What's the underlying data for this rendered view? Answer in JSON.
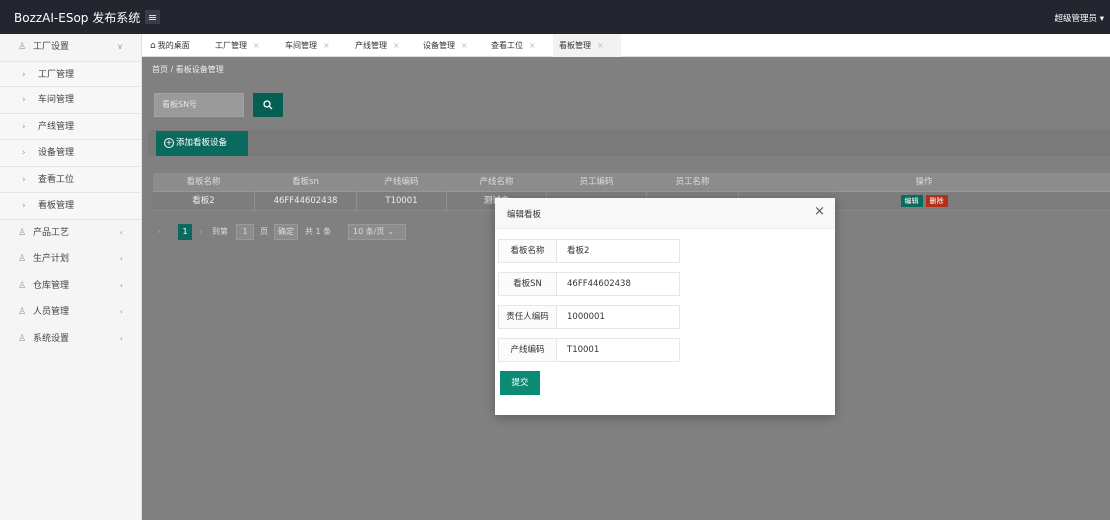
{
  "header": {
    "brand": "BozzAI-ESop 发布系统",
    "user": "超级管理员 ▾"
  },
  "sidebar": {
    "groups": [
      {
        "label": "工厂设置",
        "expanded": true
      },
      {
        "label": "产品工艺"
      },
      {
        "label": "生产计划"
      },
      {
        "label": "仓库管理"
      },
      {
        "label": "人员管理"
      },
      {
        "label": "系统设置"
      }
    ],
    "sub_items": [
      {
        "label": "工厂管理"
      },
      {
        "label": "车间管理"
      },
      {
        "label": "产线管理"
      },
      {
        "label": "设备管理"
      },
      {
        "label": "查看工位"
      },
      {
        "label": "看板管理"
      }
    ]
  },
  "tabs": [
    {
      "label": "我的桌面"
    },
    {
      "label": "工厂管理"
    },
    {
      "label": "车间管理"
    },
    {
      "label": "产线管理"
    },
    {
      "label": "设备管理"
    },
    {
      "label": "查看工位"
    },
    {
      "label": "看板管理",
      "active": true
    }
  ],
  "breadcrumb": "首页 / 看板设备管理",
  "search": {
    "placeholder": "看板SN号"
  },
  "add_button": "添加看板设备",
  "table": {
    "columns": [
      "看板名称",
      "看板sn",
      "产线编码",
      "产线名称",
      "员工编码",
      "员工名称",
      "操作"
    ],
    "rows": [
      {
        "name": "看板2",
        "sn": "46FF44602438",
        "line_code": "T10001",
        "line_name": "测试产",
        "emp_code": "",
        "emp_name": "",
        "edit": "编辑",
        "delete": "删除"
      }
    ]
  },
  "pagination": {
    "current": "1",
    "goto_label": "到第",
    "goto_value": "1",
    "page_unit": "页",
    "confirm": "确定",
    "total": "共 1 条",
    "page_size": "10 条/页"
  },
  "modal": {
    "title": "编辑看板",
    "fields": [
      {
        "label": "看板名称",
        "value": "看板2"
      },
      {
        "label": "看板SN",
        "value": "46FF44602438"
      },
      {
        "label": "责任人编码",
        "value": "1000001"
      },
      {
        "label": "产线编码",
        "value": "T10001"
      }
    ],
    "submit": "提交"
  }
}
